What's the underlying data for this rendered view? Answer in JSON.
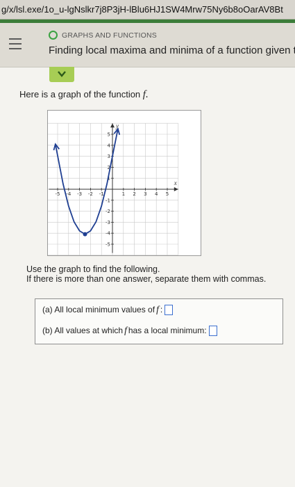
{
  "browser": {
    "url": "g/x/lsl.exe/1o_u-lgNslkr7j8P3jH-lBlu6HJ1SW4Mrw75Ny6b8oOarAV8Bt"
  },
  "header": {
    "topic": "GRAPHS AND FUNCTIONS",
    "title": "Finding local maxima and minima of a function given the"
  },
  "intro": {
    "text": "Here is a graph of the function",
    "fn": "f."
  },
  "chart_data": {
    "type": "line",
    "x": [
      -5.2,
      -4.5,
      -4,
      -3.5,
      -3,
      -2.5,
      -2,
      -1.5,
      -1,
      -0.5,
      0,
      0.5
    ],
    "y": [
      4.1,
      0.48,
      -1.53,
      -2.97,
      -3.79,
      -4.09,
      -3.79,
      -2.97,
      -1.53,
      0.48,
      3.01,
      5.5
    ],
    "local_minimum": {
      "x": -2.5,
      "y": -4.09
    },
    "xlim": [
      -6,
      6
    ],
    "ylim": [
      -6,
      6
    ],
    "x_ticks": [
      "-5",
      "-4",
      "-3",
      "-2",
      "-1",
      "1",
      "2",
      "3",
      "4",
      "5"
    ],
    "y_ticks": [
      "5",
      "4",
      "3",
      "2",
      "1",
      "-1",
      "-2",
      "-3",
      "-4",
      "-5"
    ],
    "xlabel": "x",
    "ylabel": "y",
    "grid": true,
    "color": "#1f3f92"
  },
  "instructions": {
    "line1": "Use the graph to find the following.",
    "line2": "If there is more than one answer, separate them with commas."
  },
  "questions": {
    "a_prefix": "(a) All local minimum values of",
    "a_fn": "f",
    "a_suffix": ":",
    "a_value": "",
    "b_prefix": "(b) All values at which",
    "b_fn": "f",
    "b_suffix": "has a local minimum:",
    "b_value": ""
  }
}
